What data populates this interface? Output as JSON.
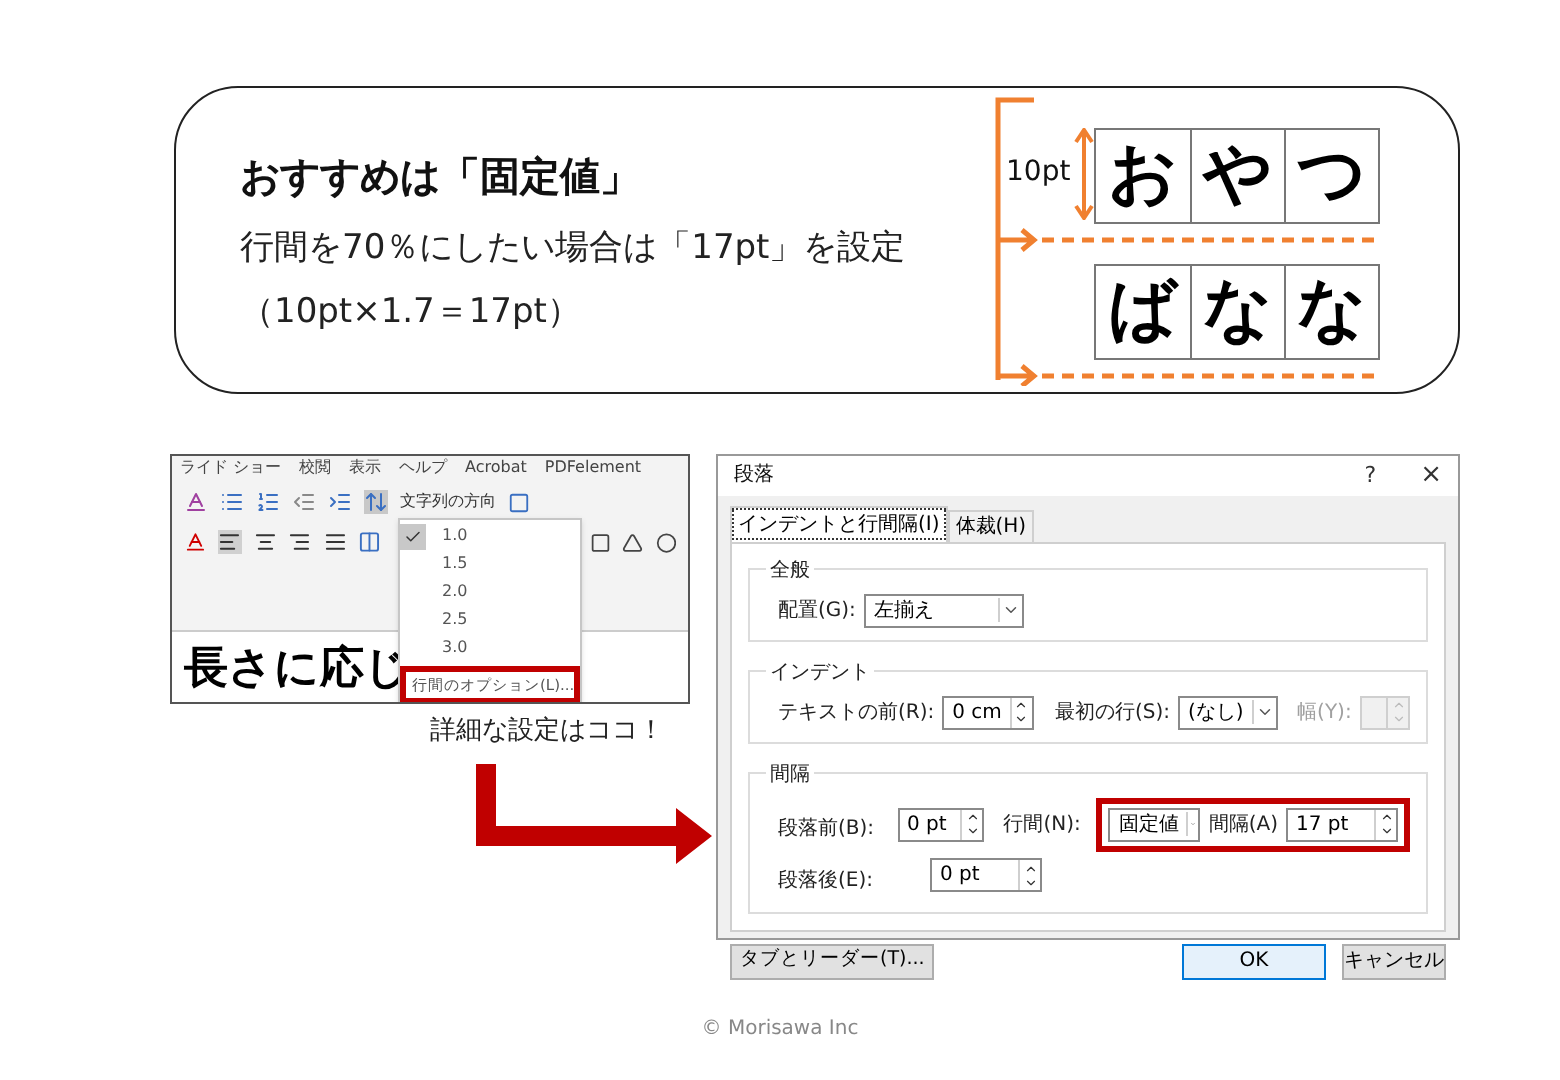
{
  "tip": {
    "title": "おすすめは「固定値」",
    "lines": [
      "行間を70％にしたい場合は「17pt」を設定",
      "（10pt×1.7＝17pt）"
    ],
    "example": {
      "size_label": "10pt",
      "rows": [
        [
          "お",
          "や",
          "つ"
        ],
        [
          "ば",
          "な",
          "な"
        ]
      ]
    }
  },
  "ribbon": {
    "tabs": [
      "ライド ショー",
      "校閲",
      "表示",
      "ヘルプ",
      "Acrobat",
      "PDFelement"
    ],
    "direction_label": "文字列の方向",
    "menu": [
      {
        "label": "1.0",
        "selected": true
      },
      {
        "label": "1.5",
        "selected": false
      },
      {
        "label": "2.0",
        "selected": false
      },
      {
        "label": "2.5",
        "selected": false
      },
      {
        "label": "3.0",
        "selected": false
      }
    ],
    "option": "行間のオプション(L)...",
    "doc_text": "長さに応じ"
  },
  "callout": "詳細な設定はココ！",
  "dialog": {
    "title": "段落",
    "help": "?",
    "close": "×",
    "tabs": [
      {
        "label": "インデントと行間隔(I)",
        "selected": true
      },
      {
        "label": "体裁(H)",
        "selected": false
      }
    ],
    "general": {
      "title": "全般",
      "align": {
        "label": "配置(G):",
        "value": "左揃え"
      }
    },
    "indent": {
      "title": "インデント",
      "before": {
        "label": "テキストの前(R):",
        "value": "0 cm"
      },
      "first_line": {
        "label": "最初の行(S):",
        "value": "(なし)"
      },
      "width": {
        "label": "幅(Y):",
        "disabled": true
      }
    },
    "spacing": {
      "title": "間隔",
      "before": {
        "label": "段落前(B):",
        "value": "0 pt"
      },
      "after": {
        "label": "段落後(E):",
        "value": "0 pt"
      },
      "line": {
        "label": "行間(N):",
        "value": "固定値"
      },
      "at": {
        "label": "間隔(A)",
        "value": "17 pt"
      }
    },
    "buttons": {
      "tabs": "タブとリーダー(T)...",
      "ok": "OK",
      "cancel": "キャンセル"
    }
  },
  "footer": "© Morisawa Inc"
}
